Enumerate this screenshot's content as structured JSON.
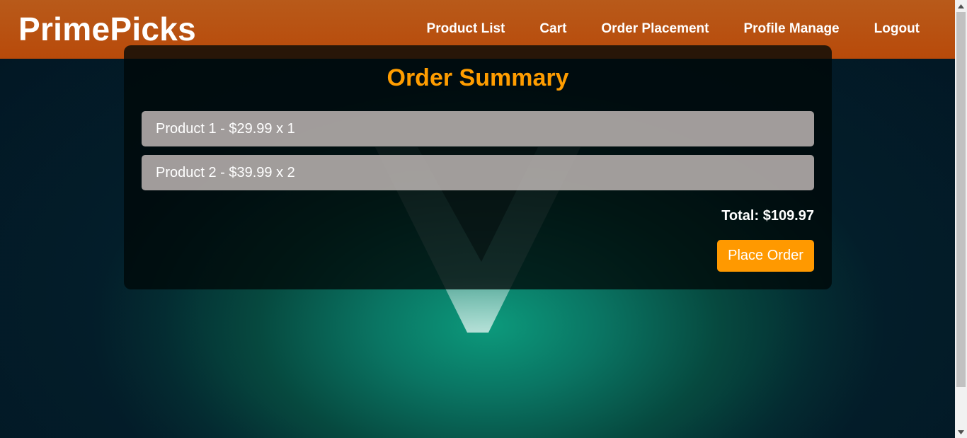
{
  "brand": "PrimePicks",
  "nav": {
    "items": [
      {
        "label": "Product List"
      },
      {
        "label": "Cart"
      },
      {
        "label": "Order Placement"
      },
      {
        "label": "Profile Manage"
      },
      {
        "label": "Logout"
      }
    ]
  },
  "order": {
    "title": "Order Summary",
    "items": [
      {
        "text": "Product 1 - $29.99 x 1"
      },
      {
        "text": "Product 2 - $39.99 x 2"
      }
    ],
    "total": "Total: $109.97",
    "place_order_label": "Place Order"
  },
  "colors": {
    "header": "#b84a0a",
    "accent": "#ff9900",
    "title": "#ff9d00",
    "item_bg": "#9e9694"
  },
  "icons": {
    "background_logo": "v-logo-icon",
    "scroll_up": "triangle-up-icon",
    "scroll_down": "triangle-down-icon"
  }
}
